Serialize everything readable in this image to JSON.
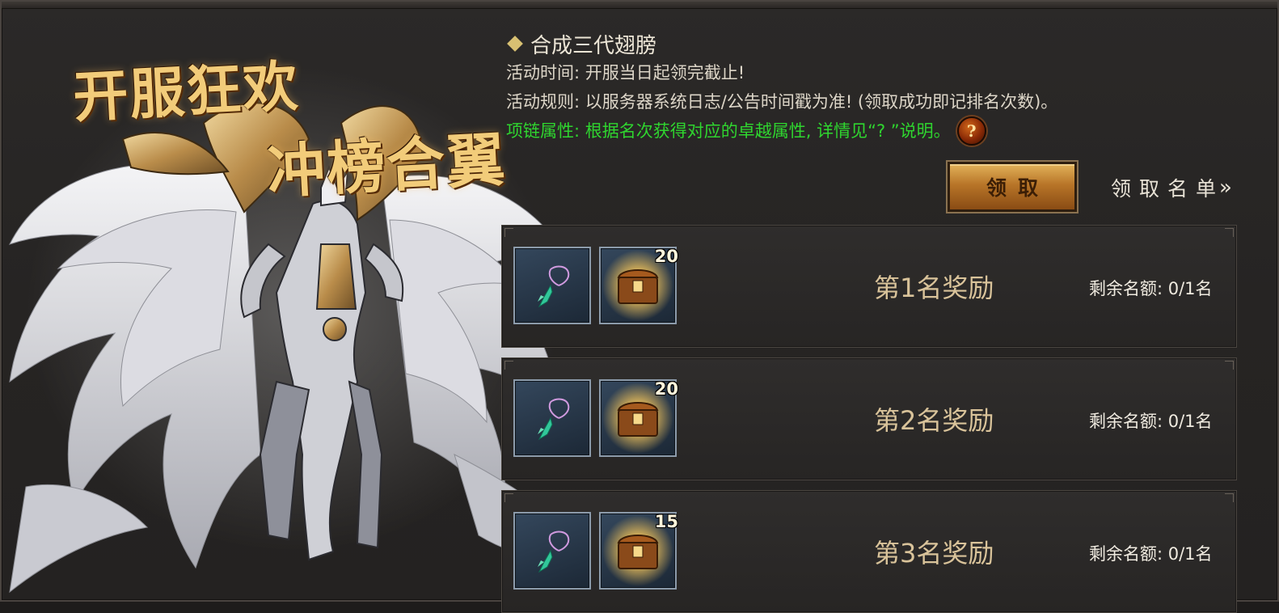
{
  "banner": {
    "line1": "开服狂欢",
    "line2": "冲榜合翼"
  },
  "info": {
    "title": "合成三代翅膀",
    "time": "活动时间: 开服当日起领完截止!",
    "rule": "活动规则: 以服务器系统日志/公告时间戳为准! (领取成功即记排名次数)。",
    "attr": "项链属性: 根据名次获得对应的卓越属性, 详情见“? ”说明。",
    "help_icon": "question-mark-icon"
  },
  "actions": {
    "claim_label": "领取",
    "list_label": "领取名单",
    "list_icon": "double-chevron-right-icon"
  },
  "rewards": [
    {
      "label": "第1名奖励",
      "item1_icon": "necklace-icon",
      "item2_icon": "golden-chest-icon",
      "item2_count": "20",
      "quota": "剩余名额: 0/1名"
    },
    {
      "label": "第2名奖励",
      "item1_icon": "necklace-icon",
      "item2_icon": "golden-chest-icon",
      "item2_count": "20",
      "quota": "剩余名额: 0/1名"
    },
    {
      "label": "第3名奖励",
      "item1_icon": "necklace-icon",
      "item2_icon": "golden-chest-icon",
      "item2_count": "15",
      "quota": "剩余名额: 0/1名"
    }
  ],
  "colors": {
    "accent_gold": "#d8c072",
    "attr_green": "#2fd52f",
    "rank_text": "#d9c39a"
  }
}
